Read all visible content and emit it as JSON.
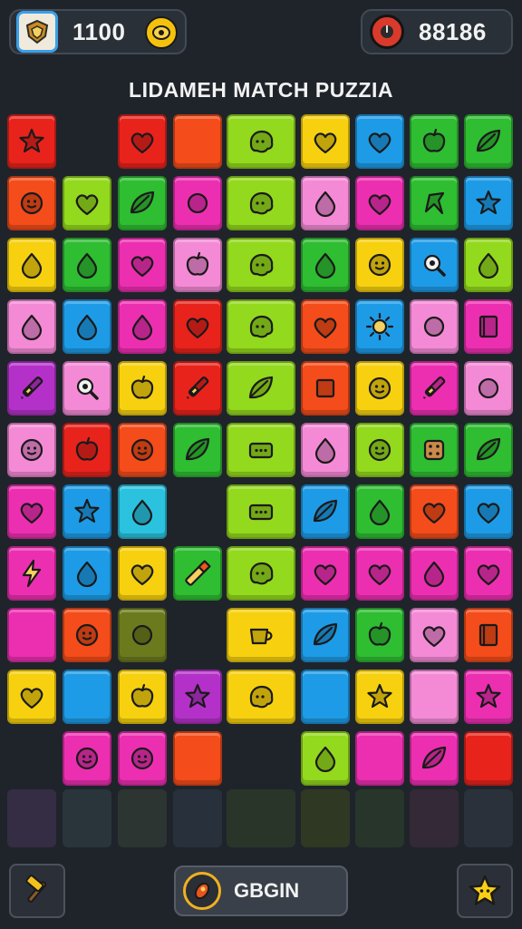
{
  "header": {
    "score_left": "1100",
    "score_right": "88186"
  },
  "title": "LIDAMEH MATCH PUZZIA",
  "footer": {
    "start_label": "GBGIN"
  },
  "colors": {
    "red": "#e8231c",
    "orange": "#f44c1a",
    "yellow": "#f7d10f",
    "lime": "#93d91d",
    "green": "#2fbd32",
    "blue": "#1e9be6",
    "pink": "#ec2fb1",
    "lightpink": "#f48ad6",
    "purple": "#b431c9",
    "cyan": "#2ac2df"
  },
  "board": {
    "columns": 10,
    "rows": 11,
    "tiles": [
      {
        "r": 0,
        "c": 0,
        "color": "red",
        "icon": "star"
      },
      {
        "r": 0,
        "c": 2,
        "color": "red",
        "icon": "heart"
      },
      {
        "r": 0,
        "c": 3,
        "color": "orange",
        "icon": "none"
      },
      {
        "r": 0,
        "c": 4,
        "color": "lime",
        "icon": "blob",
        "wide": true
      },
      {
        "r": 0,
        "c": 5,
        "color": "yellow",
        "icon": "heart"
      },
      {
        "r": 0,
        "c": 6,
        "color": "blue",
        "icon": "heart"
      },
      {
        "r": 0,
        "c": 7,
        "color": "green",
        "icon": "apple"
      },
      {
        "r": 0,
        "c": 8,
        "color": "green",
        "icon": "leaf"
      },
      {
        "r": 1,
        "c": 0,
        "color": "orange",
        "icon": "face"
      },
      {
        "r": 1,
        "c": 1,
        "color": "lime",
        "icon": "heart"
      },
      {
        "r": 1,
        "c": 2,
        "color": "green",
        "icon": "leaf"
      },
      {
        "r": 1,
        "c": 3,
        "color": "pink",
        "icon": "circle"
      },
      {
        "r": 1,
        "c": 4,
        "color": "lime",
        "icon": "blob",
        "wide": true
      },
      {
        "r": 1,
        "c": 5,
        "color": "lightpink",
        "icon": "drop"
      },
      {
        "r": 1,
        "c": 6,
        "color": "pink",
        "icon": "heart"
      },
      {
        "r": 1,
        "c": 7,
        "color": "green",
        "icon": "arrow"
      },
      {
        "r": 1,
        "c": 8,
        "color": "blue",
        "icon": "star"
      },
      {
        "r": 2,
        "c": 0,
        "color": "yellow",
        "icon": "drop"
      },
      {
        "r": 2,
        "c": 1,
        "color": "green",
        "icon": "drop"
      },
      {
        "r": 2,
        "c": 2,
        "color": "pink",
        "icon": "heart"
      },
      {
        "r": 2,
        "c": 3,
        "color": "lightpink",
        "icon": "apple"
      },
      {
        "r": 2,
        "c": 4,
        "color": "lime",
        "icon": "blob",
        "wide": true
      },
      {
        "r": 2,
        "c": 5,
        "color": "green",
        "icon": "drop"
      },
      {
        "r": 2,
        "c": 6,
        "color": "yellow",
        "icon": "face"
      },
      {
        "r": 2,
        "c": 7,
        "color": "blue",
        "icon": "magnifier"
      },
      {
        "r": 2,
        "c": 8,
        "color": "lime",
        "icon": "drop"
      },
      {
        "r": 3,
        "c": 0,
        "color": "lightpink",
        "icon": "drop"
      },
      {
        "r": 3,
        "c": 1,
        "color": "blue",
        "icon": "drop"
      },
      {
        "r": 3,
        "c": 2,
        "color": "pink",
        "icon": "drop"
      },
      {
        "r": 3,
        "c": 3,
        "color": "red",
        "icon": "heart"
      },
      {
        "r": 3,
        "c": 4,
        "color": "lime",
        "icon": "blob",
        "wide": true
      },
      {
        "r": 3,
        "c": 5,
        "color": "orange",
        "icon": "heart"
      },
      {
        "r": 3,
        "c": 6,
        "color": "blue",
        "icon": "sun"
      },
      {
        "r": 3,
        "c": 7,
        "color": "lightpink",
        "icon": "circle"
      },
      {
        "r": 3,
        "c": 8,
        "color": "pink",
        "icon": "book"
      },
      {
        "r": 4,
        "c": 0,
        "color": "purple",
        "icon": "brush"
      },
      {
        "r": 4,
        "c": 1,
        "color": "lightpink",
        "icon": "magnifier"
      },
      {
        "r": 4,
        "c": 2,
        "color": "yellow",
        "icon": "apple"
      },
      {
        "r": 4,
        "c": 3,
        "color": "red",
        "icon": "brush"
      },
      {
        "r": 4,
        "c": 4,
        "color": "lime",
        "icon": "leaf",
        "wide": true
      },
      {
        "r": 4,
        "c": 5,
        "color": "orange",
        "icon": "square"
      },
      {
        "r": 4,
        "c": 6,
        "color": "yellow",
        "icon": "face"
      },
      {
        "r": 4,
        "c": 7,
        "color": "pink",
        "icon": "brush"
      },
      {
        "r": 4,
        "c": 8,
        "color": "lightpink",
        "icon": "circle"
      },
      {
        "r": 5,
        "c": 0,
        "color": "lightpink",
        "icon": "face"
      },
      {
        "r": 5,
        "c": 1,
        "color": "red",
        "icon": "apple"
      },
      {
        "r": 5,
        "c": 2,
        "color": "orange",
        "icon": "face"
      },
      {
        "r": 5,
        "c": 3,
        "color": "green",
        "icon": "leaf"
      },
      {
        "r": 5,
        "c": 4,
        "color": "lime",
        "icon": "box",
        "wide": true
      },
      {
        "r": 5,
        "c": 5,
        "color": "lightpink",
        "icon": "drop"
      },
      {
        "r": 5,
        "c": 6,
        "color": "lime",
        "icon": "face"
      },
      {
        "r": 5,
        "c": 7,
        "color": "green",
        "icon": "dice"
      },
      {
        "r": 5,
        "c": 8,
        "color": "green",
        "icon": "leaf"
      },
      {
        "r": 6,
        "c": 0,
        "color": "pink",
        "icon": "heart"
      },
      {
        "r": 6,
        "c": 1,
        "color": "blue",
        "icon": "star"
      },
      {
        "r": 6,
        "c": 2,
        "color": "cyan",
        "icon": "drop"
      },
      {
        "r": 6,
        "c": 4,
        "color": "lime",
        "icon": "box",
        "wide": true
      },
      {
        "r": 6,
        "c": 5,
        "color": "blue",
        "icon": "leaf"
      },
      {
        "r": 6,
        "c": 6,
        "color": "green",
        "icon": "drop"
      },
      {
        "r": 6,
        "c": 7,
        "color": "orange",
        "icon": "heart"
      },
      {
        "r": 6,
        "c": 8,
        "color": "blue",
        "icon": "heart"
      },
      {
        "r": 7,
        "c": 0,
        "color": "pink",
        "icon": "bolt"
      },
      {
        "r": 7,
        "c": 1,
        "color": "blue",
        "icon": "drop"
      },
      {
        "r": 7,
        "c": 2,
        "color": "yellow",
        "icon": "heart"
      },
      {
        "r": 7,
        "c": 3,
        "color": "green",
        "icon": "pencil"
      },
      {
        "r": 7,
        "c": 4,
        "color": "lime",
        "icon": "blob",
        "wide": true
      },
      {
        "r": 7,
        "c": 5,
        "color": "pink",
        "icon": "heart"
      },
      {
        "r": 7,
        "c": 6,
        "color": "pink",
        "icon": "heart"
      },
      {
        "r": 7,
        "c": 7,
        "color": "pink",
        "icon": "drop"
      },
      {
        "r": 7,
        "c": 8,
        "color": "pink",
        "icon": "heart"
      },
      {
        "r": 8,
        "c": 0,
        "color": "pink",
        "icon": "none"
      },
      {
        "r": 8,
        "c": 1,
        "color": "orange",
        "icon": "face"
      },
      {
        "r": 8,
        "c": 2,
        "color": "olive",
        "icon": "circle"
      },
      {
        "r": 8,
        "c": 4,
        "color": "yellow",
        "icon": "cup",
        "wide": true
      },
      {
        "r": 8,
        "c": 5,
        "color": "blue",
        "icon": "leaf"
      },
      {
        "r": 8,
        "c": 6,
        "color": "green",
        "icon": "apple"
      },
      {
        "r": 8,
        "c": 7,
        "color": "lightpink",
        "icon": "heart"
      },
      {
        "r": 8,
        "c": 8,
        "color": "orange",
        "icon": "book"
      },
      {
        "r": 9,
        "c": 0,
        "color": "yellow",
        "icon": "heart"
      },
      {
        "r": 9,
        "c": 1,
        "color": "blue",
        "icon": "none"
      },
      {
        "r": 9,
        "c": 2,
        "color": "yellow",
        "icon": "apple"
      },
      {
        "r": 9,
        "c": 3,
        "color": "purple",
        "icon": "star"
      },
      {
        "r": 9,
        "c": 4,
        "color": "yellow",
        "icon": "blob",
        "wide": true
      },
      {
        "r": 9,
        "c": 5,
        "color": "blue",
        "icon": "none"
      },
      {
        "r": 9,
        "c": 6,
        "color": "yellow",
        "icon": "star"
      },
      {
        "r": 9,
        "c": 7,
        "color": "lightpink",
        "icon": "none"
      },
      {
        "r": 9,
        "c": 8,
        "color": "pink",
        "icon": "star"
      },
      {
        "r": 10,
        "c": 1,
        "color": "pink",
        "icon": "face"
      },
      {
        "r": 10,
        "c": 2,
        "color": "pink",
        "icon": "face"
      },
      {
        "r": 10,
        "c": 3,
        "color": "orange",
        "icon": "none"
      },
      {
        "r": 10,
        "c": 5,
        "color": "lime",
        "icon": "drop"
      },
      {
        "r": 10,
        "c": 6,
        "color": "pink",
        "icon": "none"
      },
      {
        "r": 10,
        "c": 7,
        "color": "pink",
        "icon": "leaf"
      },
      {
        "r": 10,
        "c": 8,
        "color": "red",
        "icon": "none"
      }
    ]
  }
}
